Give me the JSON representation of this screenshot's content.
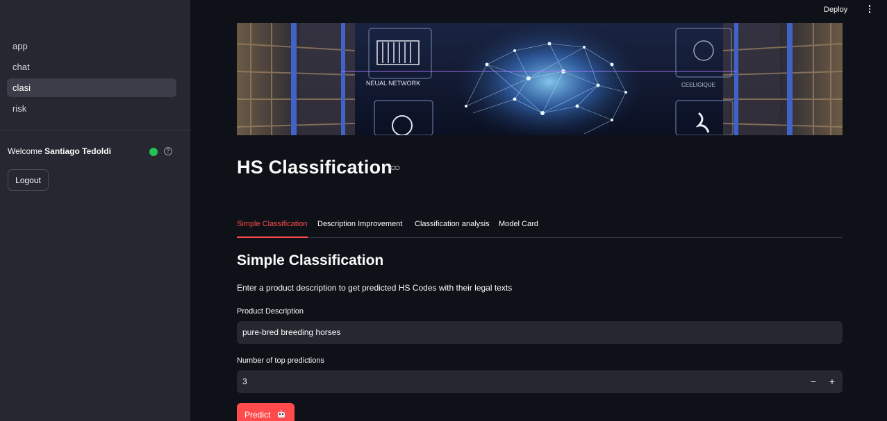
{
  "sidebar": {
    "nav_items": [
      {
        "label": "app",
        "active": false
      },
      {
        "label": "chat",
        "active": false
      },
      {
        "label": "clasi",
        "active": true
      },
      {
        "label": "risk",
        "active": false
      }
    ],
    "welcome_prefix": "Welcome",
    "user_name": "Santiago Tedoldi",
    "status_color": "#21c354",
    "logout_label": "Logout"
  },
  "header": {
    "deploy_label": "Deploy",
    "menu_icon": "vertical-dots-icon"
  },
  "banner": {
    "text_left": "NEUAL NETWORK",
    "text_right": "CEELIGIQUE"
  },
  "page": {
    "title": "HS Classification",
    "tabs": [
      {
        "label": "Simple Classification",
        "active": true
      },
      {
        "label": "Description Improvement",
        "active": false
      },
      {
        "label": "Classification analysis",
        "active": false
      },
      {
        "label": "Model Card",
        "active": false
      }
    ],
    "section_title": "Simple Classification",
    "section_desc": "Enter a product description to get predicted HS Codes with their legal texts",
    "product_label": "Product Description",
    "product_value": "pure-bred breeding horses",
    "top_label": "Number of top predictions",
    "top_value": "3",
    "minus": "−",
    "plus": "+",
    "predict_label": "Predict"
  },
  "colors": {
    "accent": "#ff4b4b",
    "background": "#0e1117",
    "sidebar": "#262730"
  }
}
